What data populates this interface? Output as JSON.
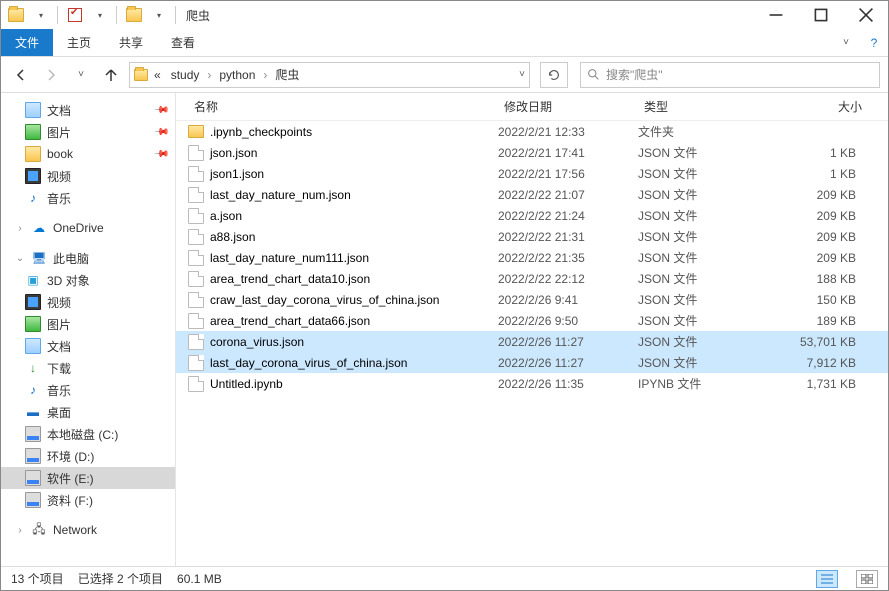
{
  "titlebar": {
    "title": "爬虫"
  },
  "ribbon": {
    "file": "文件",
    "home": "主页",
    "share": "共享",
    "view": "查看"
  },
  "breadcrumb": {
    "prefix": "«",
    "parts": [
      "study",
      "python",
      "爬虫"
    ]
  },
  "search": {
    "placeholder": "搜索\"爬虫\""
  },
  "sidebar": {
    "quick": [
      {
        "label": "文档",
        "icon": "doc",
        "pinned": true
      },
      {
        "label": "图片",
        "icon": "pic",
        "pinned": true
      },
      {
        "label": "book",
        "icon": "book",
        "pinned": true
      },
      {
        "label": "视频",
        "icon": "vid",
        "pinned": false
      },
      {
        "label": "音乐",
        "icon": "music",
        "pinned": false,
        "glyph": "♪"
      }
    ],
    "onedrive": {
      "label": "OneDrive",
      "glyph": "☁"
    },
    "pc": {
      "label": "此电脑"
    },
    "pc_items": [
      {
        "label": "3D 对象",
        "icon": "obj3d",
        "glyph": "▣"
      },
      {
        "label": "视频",
        "icon": "vid"
      },
      {
        "label": "图片",
        "icon": "pic"
      },
      {
        "label": "文档",
        "icon": "doc"
      },
      {
        "label": "下载",
        "icon": "dl",
        "glyph": "↓"
      },
      {
        "label": "音乐",
        "icon": "music",
        "glyph": "♪"
      },
      {
        "label": "桌面",
        "icon": "desk",
        "glyph": "▬"
      },
      {
        "label": "本地磁盘 (C:)",
        "icon": "disk"
      },
      {
        "label": "环境 (D:)",
        "icon": "disk"
      },
      {
        "label": "软件 (E:)",
        "icon": "disk",
        "selected": true
      },
      {
        "label": "资料 (F:)",
        "icon": "disk"
      }
    ],
    "network": {
      "label": "Network",
      "glyph": "🖧"
    }
  },
  "columns": {
    "name": "名称",
    "date": "修改日期",
    "type": "类型",
    "size": "大小"
  },
  "files": [
    {
      "name": ".ipynb_checkpoints",
      "date": "2022/2/21 12:33",
      "type": "文件夹",
      "size": "",
      "folder": true
    },
    {
      "name": "json.json",
      "date": "2022/2/21 17:41",
      "type": "JSON 文件",
      "size": "1 KB"
    },
    {
      "name": "json1.json",
      "date": "2022/2/21 17:56",
      "type": "JSON 文件",
      "size": "1 KB"
    },
    {
      "name": "last_day_nature_num.json",
      "date": "2022/2/22 21:07",
      "type": "JSON 文件",
      "size": "209 KB"
    },
    {
      "name": "a.json",
      "date": "2022/2/22 21:24",
      "type": "JSON 文件",
      "size": "209 KB"
    },
    {
      "name": "a88.json",
      "date": "2022/2/22 21:31",
      "type": "JSON 文件",
      "size": "209 KB"
    },
    {
      "name": "last_day_nature_num111.json",
      "date": "2022/2/22 21:35",
      "type": "JSON 文件",
      "size": "209 KB"
    },
    {
      "name": "area_trend_chart_data10.json",
      "date": "2022/2/22 22:12",
      "type": "JSON 文件",
      "size": "188 KB"
    },
    {
      "name": "craw_last_day_corona_virus_of_china.json",
      "date": "2022/2/26 9:41",
      "type": "JSON 文件",
      "size": "150 KB"
    },
    {
      "name": "area_trend_chart_data66.json",
      "date": "2022/2/26 9:50",
      "type": "JSON 文件",
      "size": "189 KB"
    },
    {
      "name": "corona_virus.json",
      "date": "2022/2/26 11:27",
      "type": "JSON 文件",
      "size": "53,701 KB",
      "selected": true
    },
    {
      "name": "last_day_corona_virus_of_china.json",
      "date": "2022/2/26 11:27",
      "type": "JSON 文件",
      "size": "7,912 KB",
      "selected": true
    },
    {
      "name": "Untitled.ipynb",
      "date": "2022/2/26 11:35",
      "type": "IPYNB 文件",
      "size": "1,731 KB"
    }
  ],
  "status": {
    "count": "13 个项目",
    "selection": "已选择 2 个项目",
    "size": "60.1 MB"
  }
}
